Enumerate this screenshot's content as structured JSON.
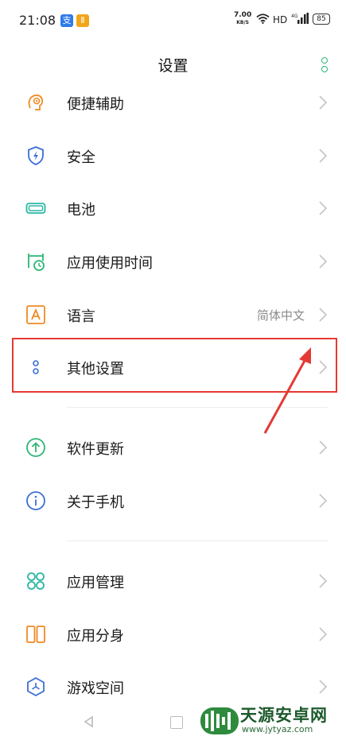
{
  "status": {
    "time": "21:08",
    "notif1": "支",
    "notif2": "Ⅱ",
    "speed_value": "7.00",
    "speed_unit": "KB/S",
    "hd": "HD",
    "signal": "4G",
    "battery": "85"
  },
  "header": {
    "title": "设置"
  },
  "rows": [
    {
      "label": "便捷辅助",
      "icon": "accessibility-icon"
    },
    {
      "label": "安全",
      "icon": "shield-icon"
    },
    {
      "label": "电池",
      "icon": "battery-icon"
    },
    {
      "label": "应用使用时间",
      "icon": "alarm-clock-icon"
    },
    {
      "label": "语言",
      "value": "简体中文",
      "icon": "language-icon"
    },
    {
      "label": "其他设置",
      "icon": "more-settings-icon"
    },
    {
      "label": "软件更新",
      "icon": "update-arrow-icon"
    },
    {
      "label": "关于手机",
      "icon": "info-icon"
    },
    {
      "label": "应用管理",
      "icon": "app-grid-icon"
    },
    {
      "label": "应用分身",
      "icon": "app-clone-icon"
    },
    {
      "label": "游戏空间",
      "icon": "game-space-icon"
    }
  ],
  "colors": {
    "accent_green": "#2bb673",
    "highlight_red": "#e53935",
    "icon_blue": "#3b6fd6",
    "icon_orange": "#f08a24"
  },
  "watermark": {
    "text": "天源安卓网",
    "url": "www.jytyaz.com"
  }
}
